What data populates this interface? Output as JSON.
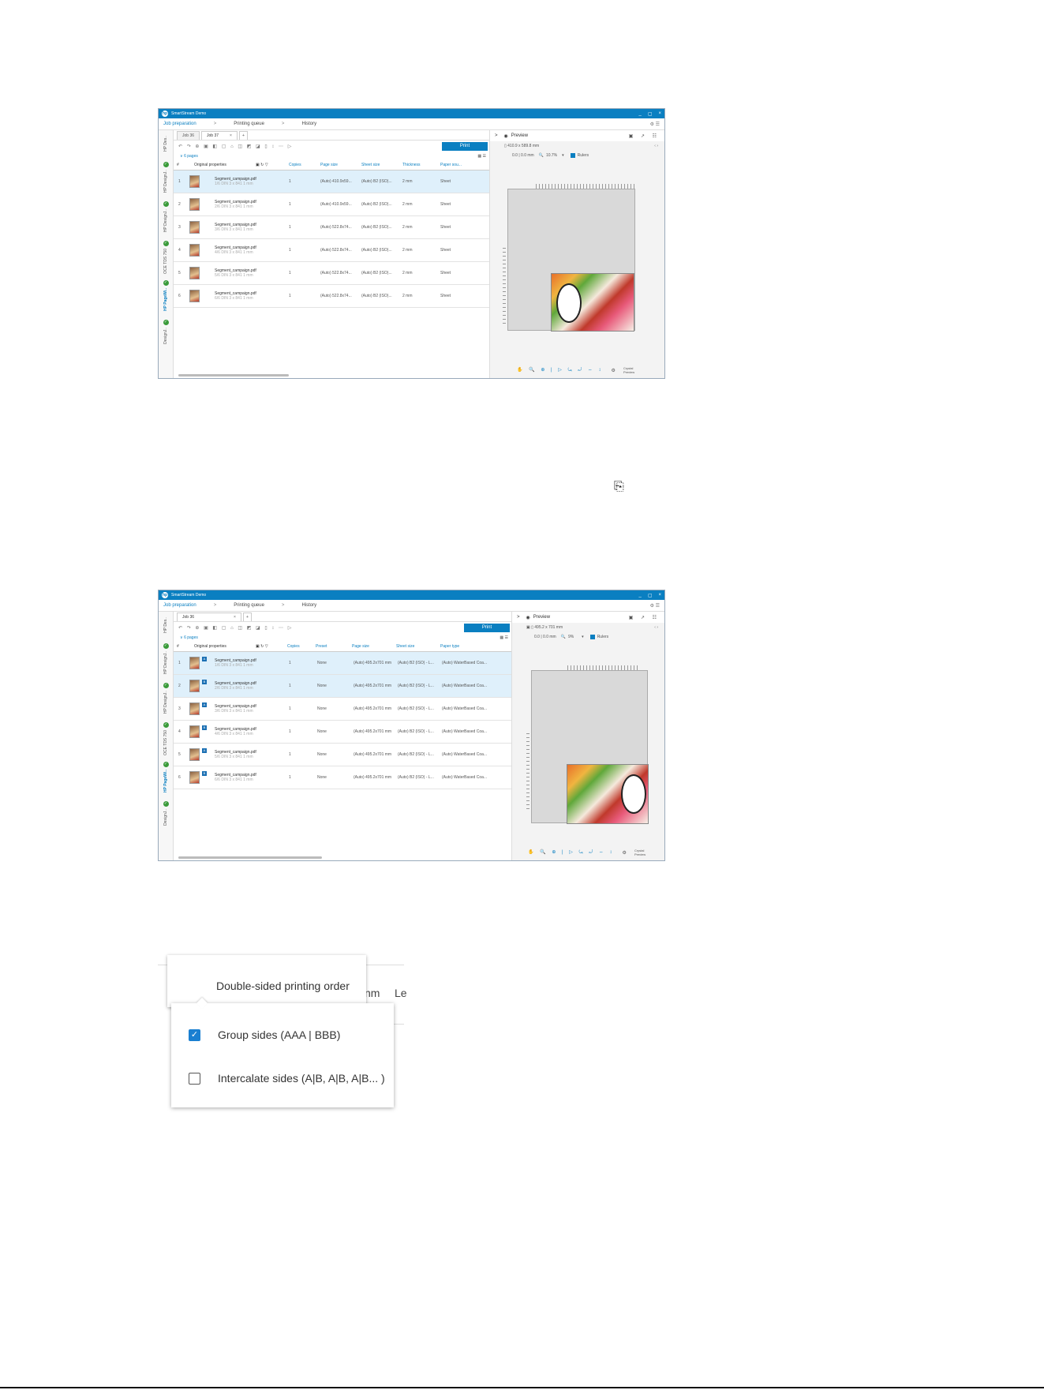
{
  "screens": [
    {
      "app_title": "SmartStream Demo",
      "window_controls": [
        "_",
        "▢",
        "×"
      ],
      "nav": {
        "items": [
          "Job preparation",
          "Printing queue",
          "History"
        ],
        "right_icons": "⚙ ☰"
      },
      "vertical_tabs": [
        "HP Des..",
        "HP DesignJ..",
        "HP DesignJ..",
        "OCE TDS 750",
        "HP PageWi..",
        "DesignJ.."
      ],
      "tabs": [
        "Job 36",
        "Job 37"
      ],
      "print_label": "Print",
      "pages_label": "6 pages",
      "headers": [
        "Original properties",
        "Copies",
        "Page size",
        "Sheet size",
        "Thickness",
        "Paper sou..."
      ],
      "rows": [
        {
          "n": "1",
          "file": "Segment_campaign.pdf",
          "sub": "1/6  DIN 3 x 841 1 mm",
          "copies": "1",
          "page": "(Auto) 410.9x59...",
          "sheet": "(Auto) B2 (ISO)...",
          "thick": "2 mm",
          "src": "Sheet"
        },
        {
          "n": "2",
          "file": "Segment_campaign.pdf",
          "sub": "2/6  DIN 3 x 841 1 mm",
          "copies": "1",
          "page": "(Auto) 410.9x59...",
          "sheet": "(Auto) B2 (ISO)...",
          "thick": "2 mm",
          "src": "Sheet"
        },
        {
          "n": "3",
          "file": "Segment_campaign.pdf",
          "sub": "3/6  DIN 3 x 841 1 mm",
          "copies": "1",
          "page": "(Auto) 522.8x74...",
          "sheet": "(Auto) B2 (ISO)...",
          "thick": "2 mm",
          "src": "Sheet"
        },
        {
          "n": "4",
          "file": "Segment_campaign.pdf",
          "sub": "4/6  DIN 3 x 841 1 mm",
          "copies": "1",
          "page": "(Auto) 522.8x74...",
          "sheet": "(Auto) B2 (ISO)...",
          "thick": "2 mm",
          "src": "Sheet"
        },
        {
          "n": "5",
          "file": "Segment_campaign.pdf",
          "sub": "5/6  DIN 3 x 841 1 mm",
          "copies": "1",
          "page": "(Auto) 522.8x74...",
          "sheet": "(Auto) B2 (ISO)...",
          "thick": "2 mm",
          "src": "Sheet"
        },
        {
          "n": "6",
          "file": "Segment_campaign.pdf",
          "sub": "6/6  DIN 3 x 841 1 mm",
          "copies": "1",
          "page": "(Auto) 522.8x74...",
          "sheet": "(Auto) B2 (ISO)...",
          "thick": "2 mm",
          "src": "Sheet"
        }
      ],
      "preview": {
        "title": "Preview",
        "dims": "410.9 x 589.8 mm",
        "origin": "0.0 | 0.0 mm",
        "zoom": "10.7%",
        "rulers_label": "Rulers",
        "crystal": "Crystal Preview"
      }
    },
    {
      "app_title": "SmartStream Demo",
      "window_controls": [
        "_",
        "▢",
        "×"
      ],
      "nav": {
        "items": [
          "Job preparation",
          "Printing queue",
          "History"
        ],
        "right_icons": "⚙ ☰"
      },
      "vertical_tabs": [
        "HP Des..",
        "HP DesignJ..",
        "HP DesignJ..",
        "OCE TDS 750",
        "HP PageWi..",
        "DesignJ.."
      ],
      "tabs": [
        "Job 36"
      ],
      "print_label": "Print",
      "pages_label": "6 pages",
      "headers": [
        "Original properties",
        "Copies",
        "Preset",
        "Page size",
        "Sheet size",
        "Paper type"
      ],
      "rows": [
        {
          "n": "1",
          "badge": "A",
          "file": "Segment_campaign.pdf",
          "sub": "1/6  DIN 3 x 841 1 mm",
          "copies": "1",
          "preset": "None",
          "page": "(Auto) 495.2x701 mm",
          "sheet": "(Auto) B2 (ISO) - L...",
          "ptype": "(Auto) WaterBased Coa..."
        },
        {
          "n": "2",
          "badge": "B",
          "file": "Segment_campaign.pdf",
          "sub": "2/6  DIN 3 x 841 1 mm",
          "copies": "1",
          "preset": "None",
          "page": "(Auto) 495.2x701 mm",
          "sheet": "(Auto) B2 (ISO) - L...",
          "ptype": "(Auto) WaterBased Coa..."
        },
        {
          "n": "3",
          "badge": "A",
          "file": "Segment_campaign.pdf",
          "sub": "3/6  DIN 3 x 841 1 mm",
          "copies": "1",
          "preset": "None",
          "page": "(Auto) 495.2x701 mm",
          "sheet": "(Auto) B2 (ISO) - L...",
          "ptype": "(Auto) WaterBased Coa..."
        },
        {
          "n": "4",
          "badge": "B",
          "file": "Segment_campaign.pdf",
          "sub": "4/6  DIN 3 x 841 1 mm",
          "copies": "1",
          "preset": "None",
          "page": "(Auto) 495.2x701 mm",
          "sheet": "(Auto) B2 (ISO) - L...",
          "ptype": "(Auto) WaterBased Coa..."
        },
        {
          "n": "5",
          "badge": "A",
          "file": "Segment_campaign.pdf",
          "sub": "5/6  DIN 3 x 841 1 mm",
          "copies": "1",
          "preset": "None",
          "page": "(Auto) 495.2x701 mm",
          "sheet": "(Auto) B2 (ISO) - L...",
          "ptype": "(Auto) WaterBased Coa..."
        },
        {
          "n": "6",
          "badge": "B",
          "file": "Segment_campaign.pdf",
          "sub": "6/6  DIN 3 x 841 1 mm",
          "copies": "1",
          "preset": "None",
          "page": "(Auto) 495.2x701 mm",
          "sheet": "(Auto) B2 (ISO) - L...",
          "ptype": "(Auto) WaterBased Coa..."
        }
      ],
      "preview": {
        "title": "Preview",
        "dims": "495.2 x 701 mm",
        "origin": "0.0 | 0.0 mm",
        "zoom": "9%",
        "rulers_label": "Rulers",
        "crystal": "Crystal Preview"
      }
    }
  ],
  "inline_icon": "print-sides-icon",
  "dropdown": {
    "button_label": "Double-sided printing order",
    "background_texts": [
      "nm",
      "Le"
    ],
    "options": [
      {
        "label": "Group sides (AAA | BBB)",
        "checked": true
      },
      {
        "label": "Intercalate sides (A|B, A|B, A|B... )",
        "checked": false
      }
    ]
  }
}
